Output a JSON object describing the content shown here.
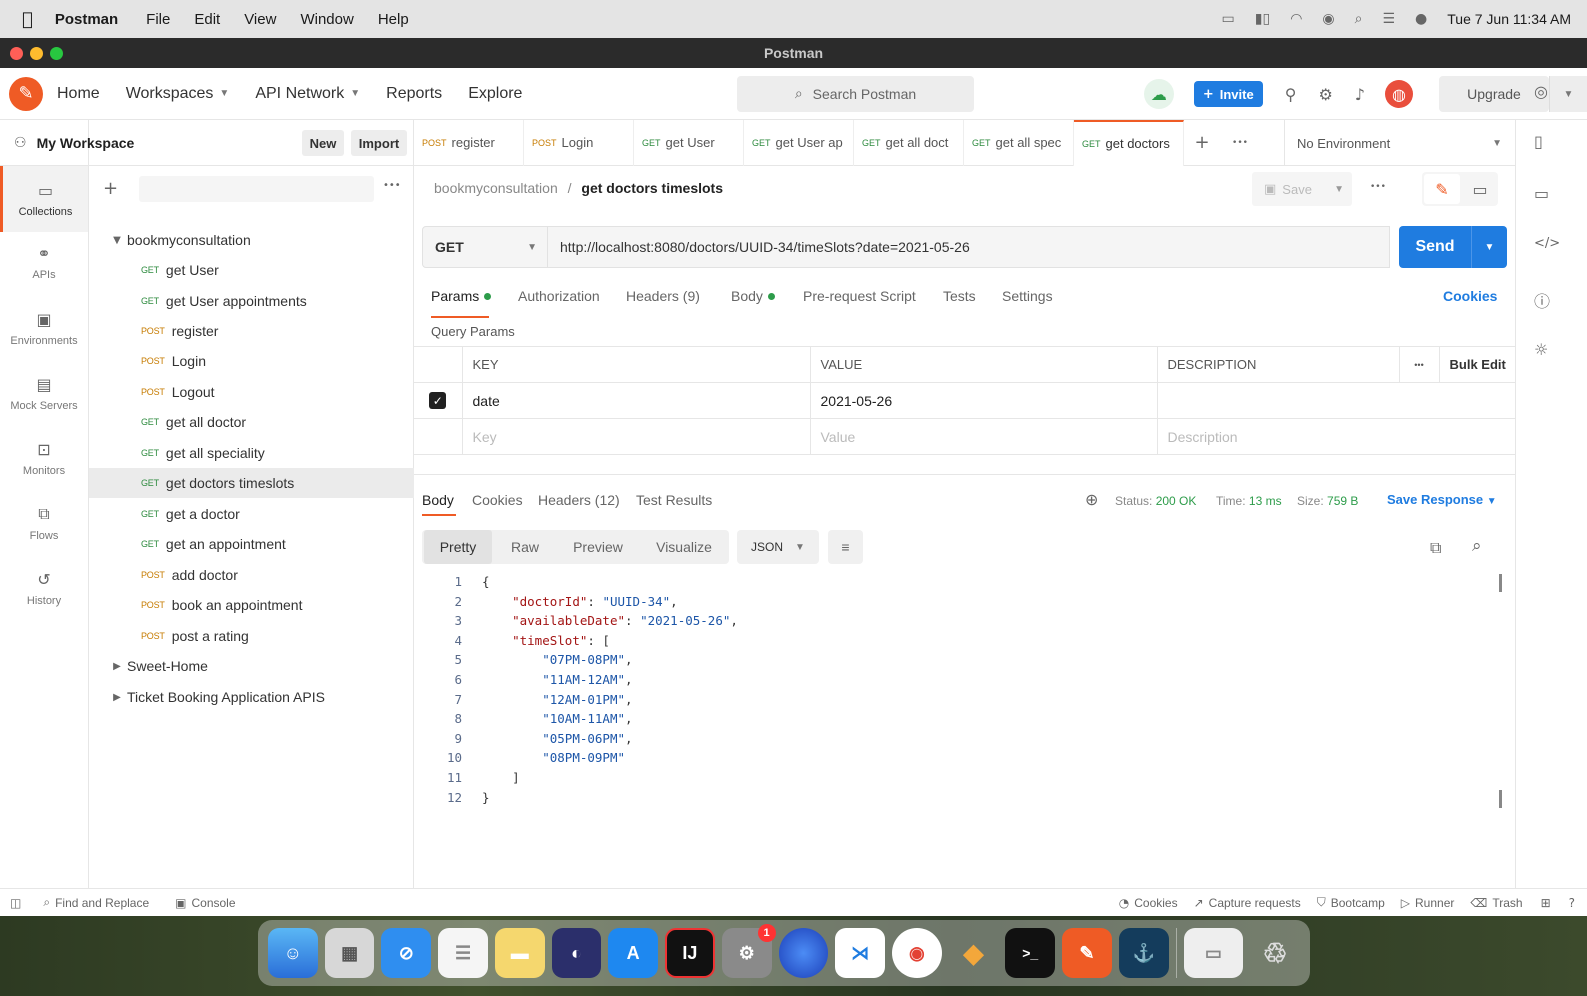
{
  "menubar": {
    "app": "Postman",
    "items": [
      "File",
      "Edit",
      "View",
      "Window",
      "Help"
    ],
    "clock": "Tue 7 Jun  11:34 AM"
  },
  "window_title": "Postman",
  "topnav": {
    "items": [
      "Home",
      "Workspaces",
      "API Network",
      "Reports",
      "Explore"
    ],
    "search_placeholder": "Search Postman",
    "invite": "Invite",
    "upgrade": "Upgrade"
  },
  "rail": [
    "Collections",
    "APIs",
    "Environments",
    "Mock Servers",
    "Monitors",
    "Flows",
    "History"
  ],
  "workspace": {
    "name": "My Workspace",
    "new": "New",
    "import": "Import"
  },
  "collections": [
    {
      "label": "bookmyconsultation",
      "type": "folder"
    },
    {
      "method": "GET",
      "label": "get User"
    },
    {
      "method": "GET",
      "label": "get User appointments"
    },
    {
      "method": "POST",
      "label": "register"
    },
    {
      "method": "POST",
      "label": "Login"
    },
    {
      "method": "POST",
      "label": "Logout"
    },
    {
      "method": "GET",
      "label": "get all doctor"
    },
    {
      "method": "GET",
      "label": "get all speciality"
    },
    {
      "method": "GET",
      "label": "get doctors timeslots",
      "selected": true
    },
    {
      "method": "GET",
      "label": "get a doctor"
    },
    {
      "method": "GET",
      "label": "get an appointment"
    },
    {
      "method": "POST",
      "label": "add doctor"
    },
    {
      "method": "POST",
      "label": "book an appointment"
    },
    {
      "method": "POST",
      "label": "post a rating"
    },
    {
      "label": "Sweet-Home",
      "type": "folder-collapsed"
    },
    {
      "label": "Ticket Booking Application APIS",
      "type": "folder-collapsed"
    }
  ],
  "tabs": [
    {
      "method": "POST",
      "label": "register"
    },
    {
      "method": "POST",
      "label": "Login"
    },
    {
      "method": "GET",
      "label": "get User"
    },
    {
      "method": "GET",
      "label": "get User ap"
    },
    {
      "method": "GET",
      "label": "get all doct"
    },
    {
      "method": "GET",
      "label": "get all spec"
    },
    {
      "method": "GET",
      "label": "get doctors",
      "active": true
    }
  ],
  "environment": "No Environment",
  "request": {
    "breadcrumb_collection": "bookmyconsultation",
    "breadcrumb_sep": "/",
    "name": "get doctors timeslots",
    "save": "Save",
    "method": "GET",
    "url": "http://localhost:8080/doctors/UUID-34/timeSlots?date=2021-05-26",
    "send": "Send",
    "tabs": [
      "Params",
      "Authorization",
      "Headers (9)",
      "Body",
      "Pre-request Script",
      "Tests",
      "Settings"
    ],
    "cookies": "Cookies",
    "query_params": "Query Params",
    "table": {
      "headers": [
        "KEY",
        "VALUE",
        "DESCRIPTION"
      ],
      "bulk_edit": "Bulk Edit",
      "rows": [
        {
          "key": "date",
          "value": "2021-05-26",
          "checked": true
        }
      ],
      "placeholder": {
        "key": "Key",
        "value": "Value",
        "description": "Description"
      }
    }
  },
  "response": {
    "tabs": [
      "Body",
      "Cookies",
      "Headers (12)",
      "Test Results"
    ],
    "status_label": "Status:",
    "status": "200 OK",
    "time_label": "Time:",
    "time": "13 ms",
    "size_label": "Size:",
    "size": "759 B",
    "save_response": "Save Response",
    "formats": [
      "Pretty",
      "Raw",
      "Preview",
      "Visualize"
    ],
    "format_select": "JSON",
    "lines": [
      "{",
      "    \"doctorId\": \"UUID-34\",",
      "    \"availableDate\": \"2021-05-26\",",
      "    \"timeSlot\": [",
      "        \"07PM-08PM\",",
      "        \"11AM-12AM\",",
      "        \"12AM-01PM\",",
      "        \"10AM-11AM\",",
      "        \"05PM-06PM\",",
      "        \"08PM-09PM\"",
      "    ]",
      "}"
    ]
  },
  "statusbar": {
    "left": [
      "Find and Replace",
      "Console"
    ],
    "right": [
      "Cookies",
      "Capture requests",
      "Bootcamp",
      "Runner",
      "Trash"
    ]
  },
  "dock_badge": "1",
  "intellij_label": "IJ"
}
